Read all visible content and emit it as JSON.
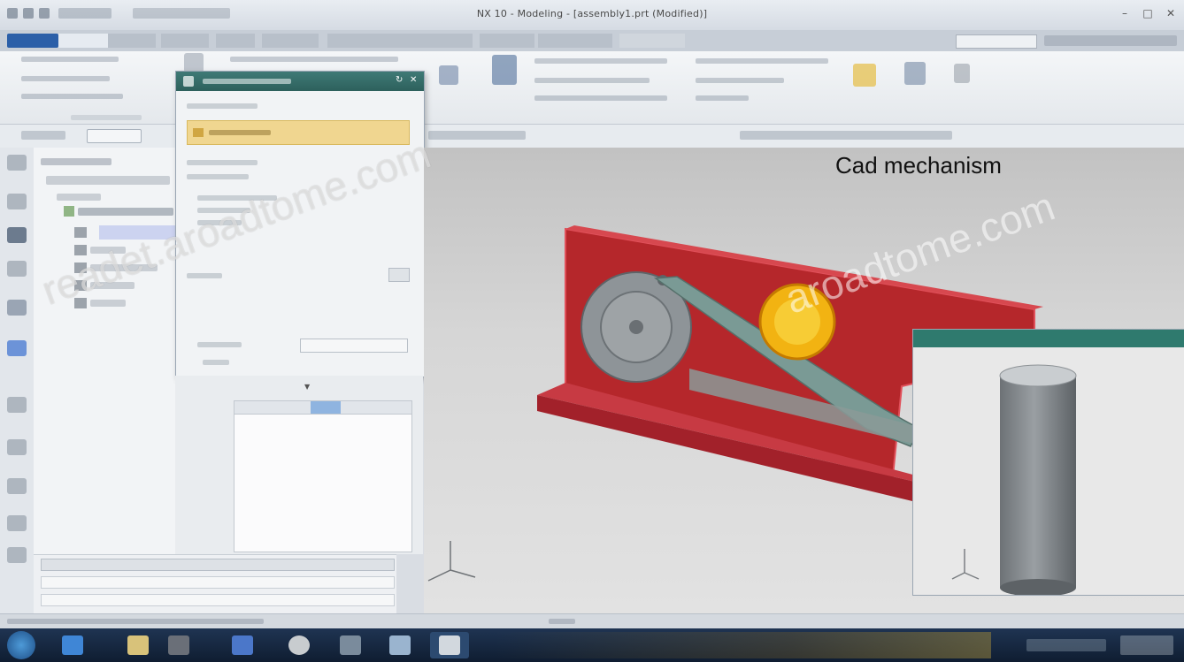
{
  "window": {
    "title": "NX 10 - Modeling - [assembly1.prt (Modified)]"
  },
  "viewport": {
    "label": "Cad mechanism"
  },
  "watermark": {
    "text": "readet.aroadtome.com",
    "text_right": "aroadtome.com"
  },
  "colors": {
    "accent": "#2b5fa8",
    "dialog_header": "#2f6b67",
    "selection": "#f0d690",
    "part_red": "#b5272b"
  }
}
